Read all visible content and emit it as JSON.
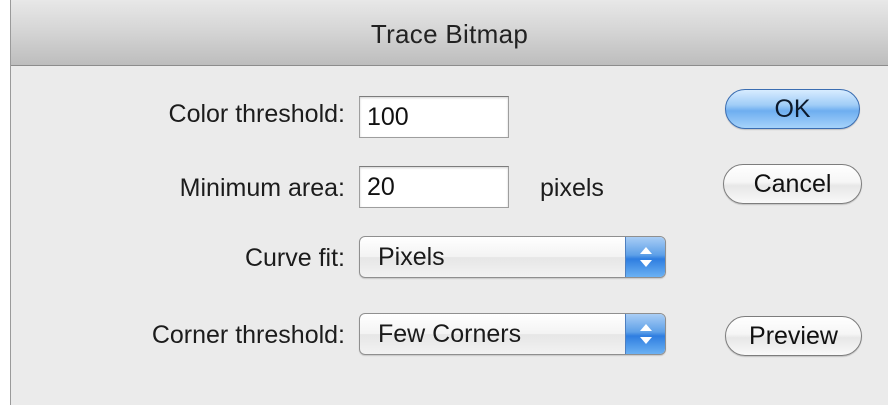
{
  "dialog": {
    "title": "Trace Bitmap"
  },
  "fields": {
    "color_threshold": {
      "label": "Color threshold:",
      "value": "100"
    },
    "minimum_area": {
      "label": "Minimum area:",
      "value": "20",
      "unit": "pixels"
    },
    "curve_fit": {
      "label": "Curve fit:",
      "value": "Pixels"
    },
    "corner_threshold": {
      "label": "Corner threshold:",
      "value": "Few Corners"
    }
  },
  "buttons": {
    "ok": "OK",
    "cancel": "Cancel",
    "preview": "Preview"
  },
  "colors": {
    "default_button": "#6eaef0",
    "stepper": "#2f7ee0"
  }
}
